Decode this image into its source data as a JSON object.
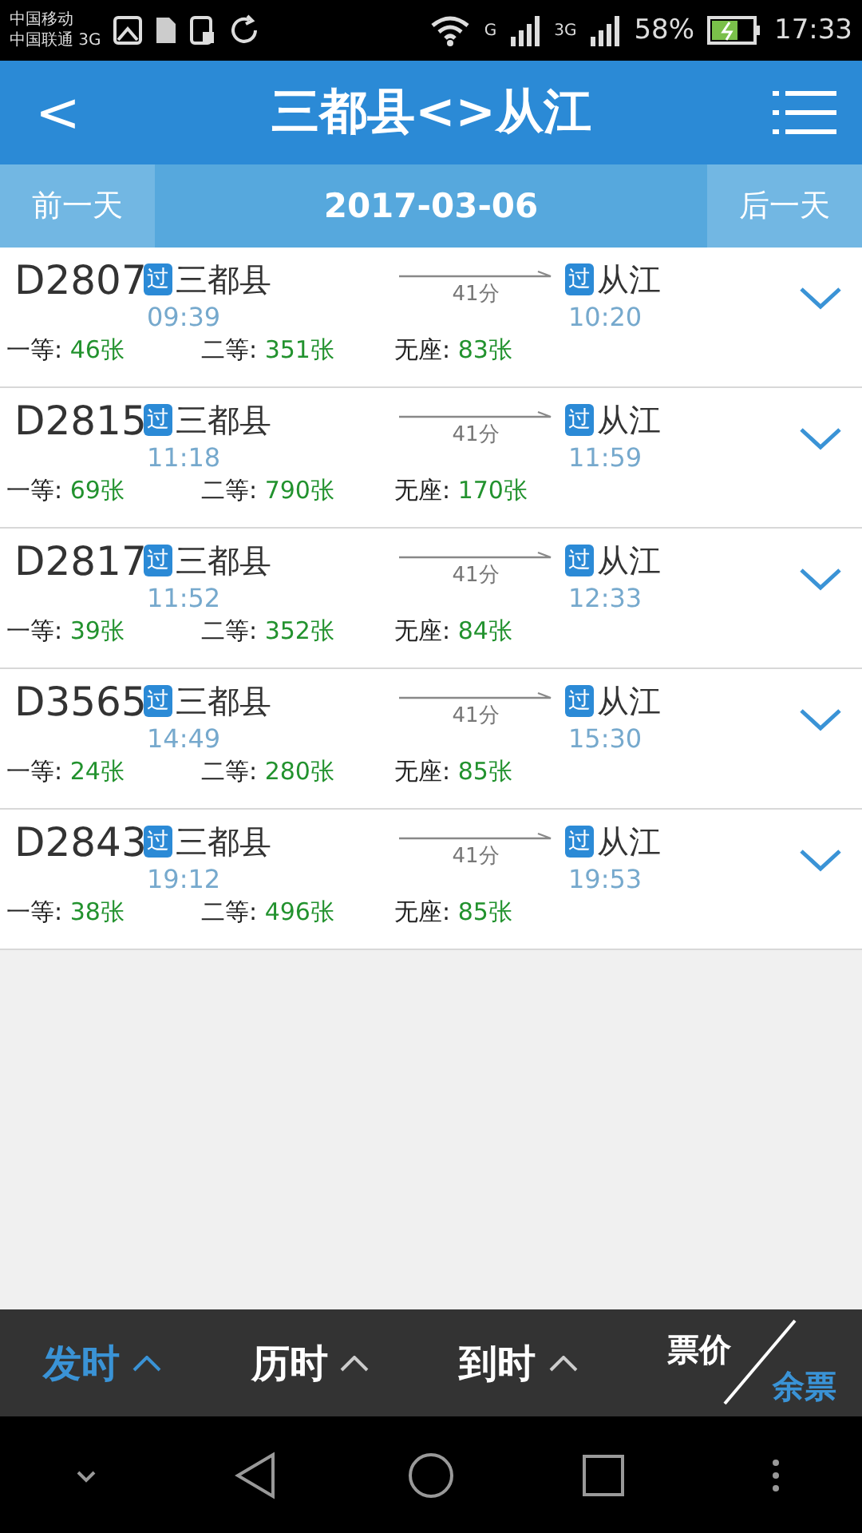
{
  "status_bar": {
    "carriers": [
      "中国移动",
      "中国联通 3G"
    ],
    "signal_labels": [
      "G",
      "3G"
    ],
    "battery": "58%",
    "time": "17:33"
  },
  "header": {
    "back": "<",
    "title": "三都县<>从江"
  },
  "date_bar": {
    "prev": "前一天",
    "date": "2017-03-06",
    "next": "后一天"
  },
  "trains": [
    {
      "number": "D2807",
      "from_badge": "过",
      "from": "三都县",
      "depart": "09:39",
      "duration": "41分",
      "to_badge": "过",
      "to": "从江",
      "arrive": "10:20",
      "seats": [
        {
          "label": "一等:",
          "count": "46张"
        },
        {
          "label": "二等:",
          "count": "351张"
        },
        {
          "label": "无座:",
          "count": "83张"
        }
      ]
    },
    {
      "number": "D2815",
      "from_badge": "过",
      "from": "三都县",
      "depart": "11:18",
      "duration": "41分",
      "to_badge": "过",
      "to": "从江",
      "arrive": "11:59",
      "seats": [
        {
          "label": "一等:",
          "count": "69张"
        },
        {
          "label": "二等:",
          "count": "790张"
        },
        {
          "label": "无座:",
          "count": "170张"
        }
      ]
    },
    {
      "number": "D2817",
      "from_badge": "过",
      "from": "三都县",
      "depart": "11:52",
      "duration": "41分",
      "to_badge": "过",
      "to": "从江",
      "arrive": "12:33",
      "seats": [
        {
          "label": "一等:",
          "count": "39张"
        },
        {
          "label": "二等:",
          "count": "352张"
        },
        {
          "label": "无座:",
          "count": "84张"
        }
      ]
    },
    {
      "number": "D3565",
      "from_badge": "过",
      "from": "三都县",
      "depart": "14:49",
      "duration": "41分",
      "to_badge": "过",
      "to": "从江",
      "arrive": "15:30",
      "seats": [
        {
          "label": "一等:",
          "count": "24张"
        },
        {
          "label": "二等:",
          "count": "280张"
        },
        {
          "label": "无座:",
          "count": "85张"
        }
      ]
    },
    {
      "number": "D2843",
      "from_badge": "过",
      "from": "三都县",
      "depart": "19:12",
      "duration": "41分",
      "to_badge": "过",
      "to": "从江",
      "arrive": "19:53",
      "seats": [
        {
          "label": "一等:",
          "count": "38张"
        },
        {
          "label": "二等:",
          "count": "496张"
        },
        {
          "label": "无座:",
          "count": "85张"
        }
      ]
    }
  ],
  "sort_bar": [
    {
      "kind": "sort",
      "label": "发时",
      "selected": true
    },
    {
      "kind": "sort",
      "label": "历时",
      "selected": false
    },
    {
      "kind": "sort",
      "label": "到时",
      "selected": false
    },
    {
      "kind": "split",
      "top": {
        "label": "票价",
        "selected": false
      },
      "bottom": {
        "label": "余票",
        "selected": true
      }
    }
  ]
}
